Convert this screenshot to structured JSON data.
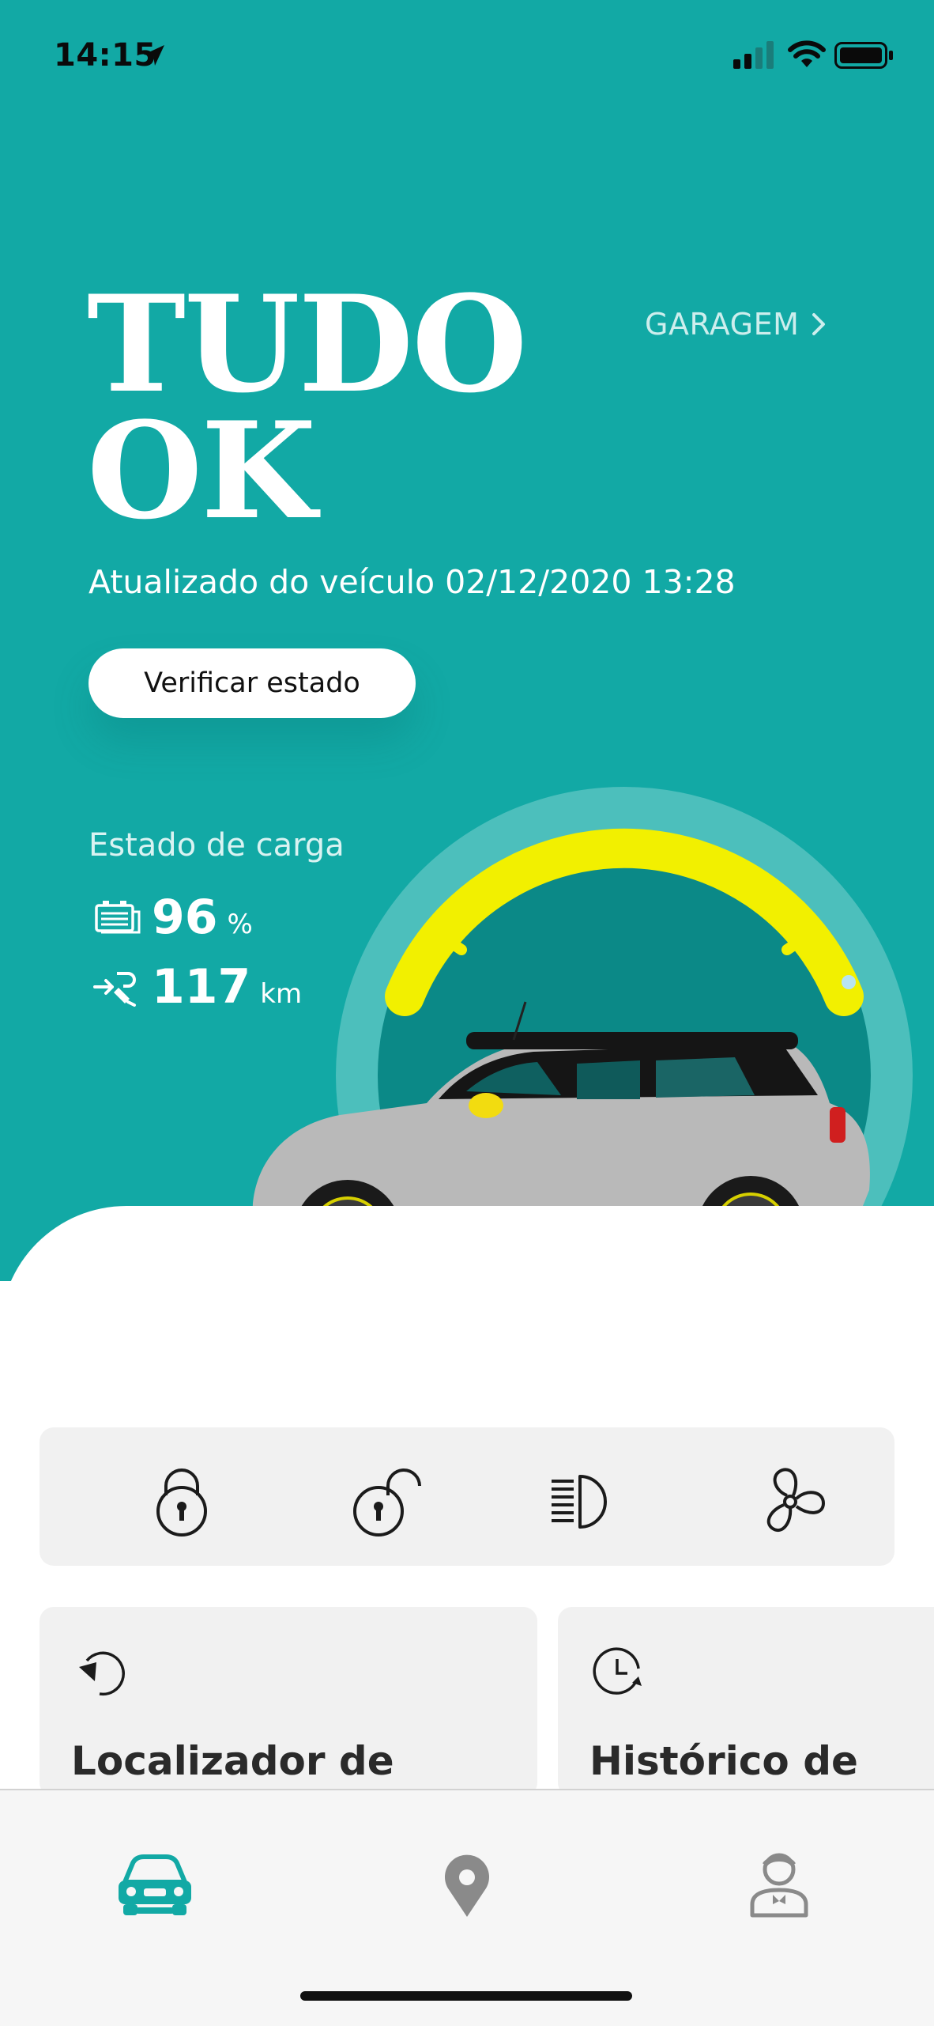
{
  "status_bar": {
    "time": "14:15"
  },
  "header": {
    "title_line1": "TUDO",
    "title_line2": "OK",
    "garage_link": "GARAGEM",
    "updated_text": "Atualizado do veículo 02/12/2020 13:28",
    "verify_button": "Verificar estado"
  },
  "charge": {
    "label": "Estado de carga",
    "battery_value": "96",
    "battery_unit": "%",
    "range_value": "117",
    "range_unit": "km"
  },
  "controls": [
    {
      "icon": "lock-icon"
    },
    {
      "icon": "unlock-icon"
    },
    {
      "icon": "headlight-icon"
    },
    {
      "icon": "fan-icon"
    }
  ],
  "cards": [
    {
      "icon": "locator-arrow-icon",
      "title": "Localizador de"
    },
    {
      "icon": "history-clock-icon",
      "title": "Histórico de"
    }
  ],
  "tabs": [
    {
      "icon": "car-icon",
      "active": true
    },
    {
      "icon": "map-pin-icon",
      "active": false
    },
    {
      "icon": "profile-icon",
      "active": false
    }
  ],
  "colors": {
    "accent": "#12a9a5",
    "gauge": "#f2f000",
    "dark_teal": "#0a8a87"
  }
}
